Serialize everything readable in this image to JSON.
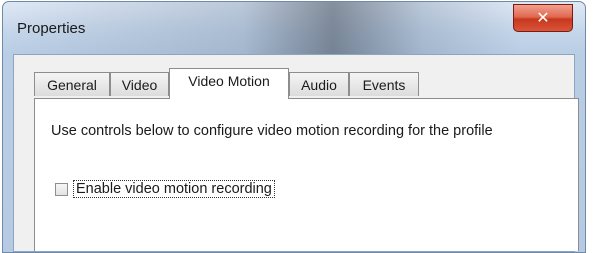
{
  "window": {
    "title": "Properties",
    "close_glyph": "✕"
  },
  "tabs": [
    {
      "label": "General",
      "active": false
    },
    {
      "label": "Video",
      "active": false
    },
    {
      "label": "Video Motion",
      "active": true
    },
    {
      "label": "Audio",
      "active": false
    },
    {
      "label": "Events",
      "active": false
    }
  ],
  "panel": {
    "description": "Use controls below to configure video motion recording for the profile",
    "checkbox": {
      "label": "Enable video motion recording",
      "checked": false
    }
  }
}
